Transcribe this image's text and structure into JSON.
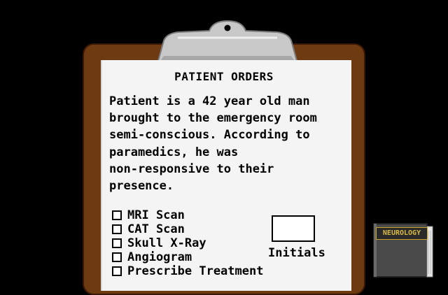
{
  "orders": {
    "title": "PATIENT ORDERS",
    "description_lines": [
      "Patient is a 42 year old man",
      "brought to the emergency room",
      "semi-conscious. According to",
      "paramedics, he was",
      "non-responsive to their",
      "presence."
    ],
    "checklist": [
      {
        "label": "MRI Scan",
        "checked": false
      },
      {
        "label": "CAT Scan",
        "checked": false
      },
      {
        "label": "Skull X-Ray",
        "checked": false
      },
      {
        "label": "Angiogram",
        "checked": false
      },
      {
        "label": "Prescribe Treatment",
        "checked": false
      }
    ],
    "initials_label": "Initials"
  },
  "reference_book": {
    "label": "NEUROLOGY"
  },
  "colors": {
    "board": "#6e3a12",
    "paper": "#f4f4f4",
    "clip": "#c8c8c8",
    "book_gold": "#c9a227"
  }
}
